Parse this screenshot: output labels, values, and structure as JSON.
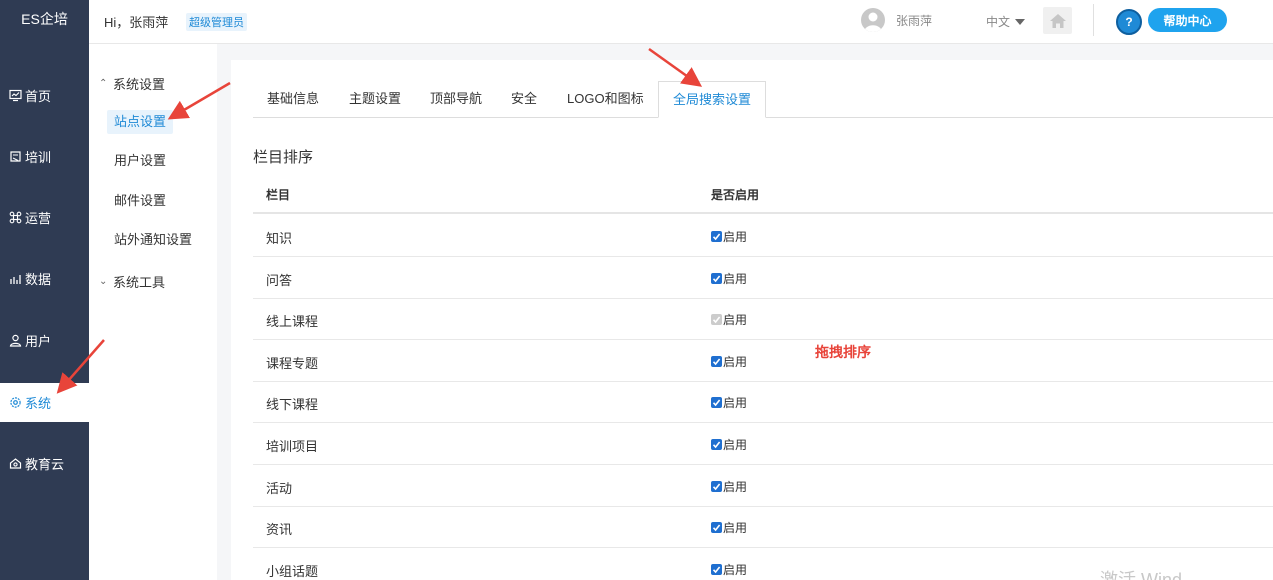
{
  "brand": "ES企培",
  "leftnav": {
    "items": [
      {
        "label": "首页",
        "icon": "dashboard-icon"
      },
      {
        "label": "培训",
        "icon": "book-icon"
      },
      {
        "label": "运营",
        "icon": "command-icon"
      },
      {
        "label": "数据",
        "icon": "chart-icon"
      },
      {
        "label": "用户",
        "icon": "user-icon"
      },
      {
        "label": "系统",
        "icon": "gear-icon",
        "active": true
      },
      {
        "label": "教育云",
        "icon": "cloud-icon"
      }
    ]
  },
  "header": {
    "greeting": "Hi，张雨萍",
    "role": "超级管理员",
    "username": "张雨萍",
    "language": "中文",
    "help_label": "帮助中心",
    "help_icon_text": "?"
  },
  "subnav": {
    "group1": "系统设置",
    "items": [
      "站点设置",
      "用户设置",
      "邮件设置",
      "站外通知设置"
    ],
    "group2": "系统工具"
  },
  "tabs": [
    "基础信息",
    "主题设置",
    "顶部导航",
    "安全",
    "LOGO和图标",
    "全局搜索设置"
  ],
  "section_title": "栏目排序",
  "table": {
    "headers": [
      "栏目",
      "是否启用"
    ],
    "enable_label": "启用",
    "rows": [
      {
        "name": "知识",
        "checked": true,
        "disabled": false
      },
      {
        "name": "问答",
        "checked": true,
        "disabled": false
      },
      {
        "name": "线上课程",
        "checked": true,
        "disabled": true
      },
      {
        "name": "课程专题",
        "checked": true,
        "disabled": false
      },
      {
        "name": "线下课程",
        "checked": true,
        "disabled": false
      },
      {
        "name": "培训项目",
        "checked": true,
        "disabled": false
      },
      {
        "name": "活动",
        "checked": true,
        "disabled": false
      },
      {
        "name": "资讯",
        "checked": true,
        "disabled": false
      },
      {
        "name": "小组话题",
        "checked": true,
        "disabled": false
      }
    ]
  },
  "annotation": "拖拽排序",
  "watermark": "激活 Wind",
  "colors": {
    "nav_bg": "#2f3b53",
    "accent": "#1f8ad6",
    "annotation": "#e8443a"
  }
}
